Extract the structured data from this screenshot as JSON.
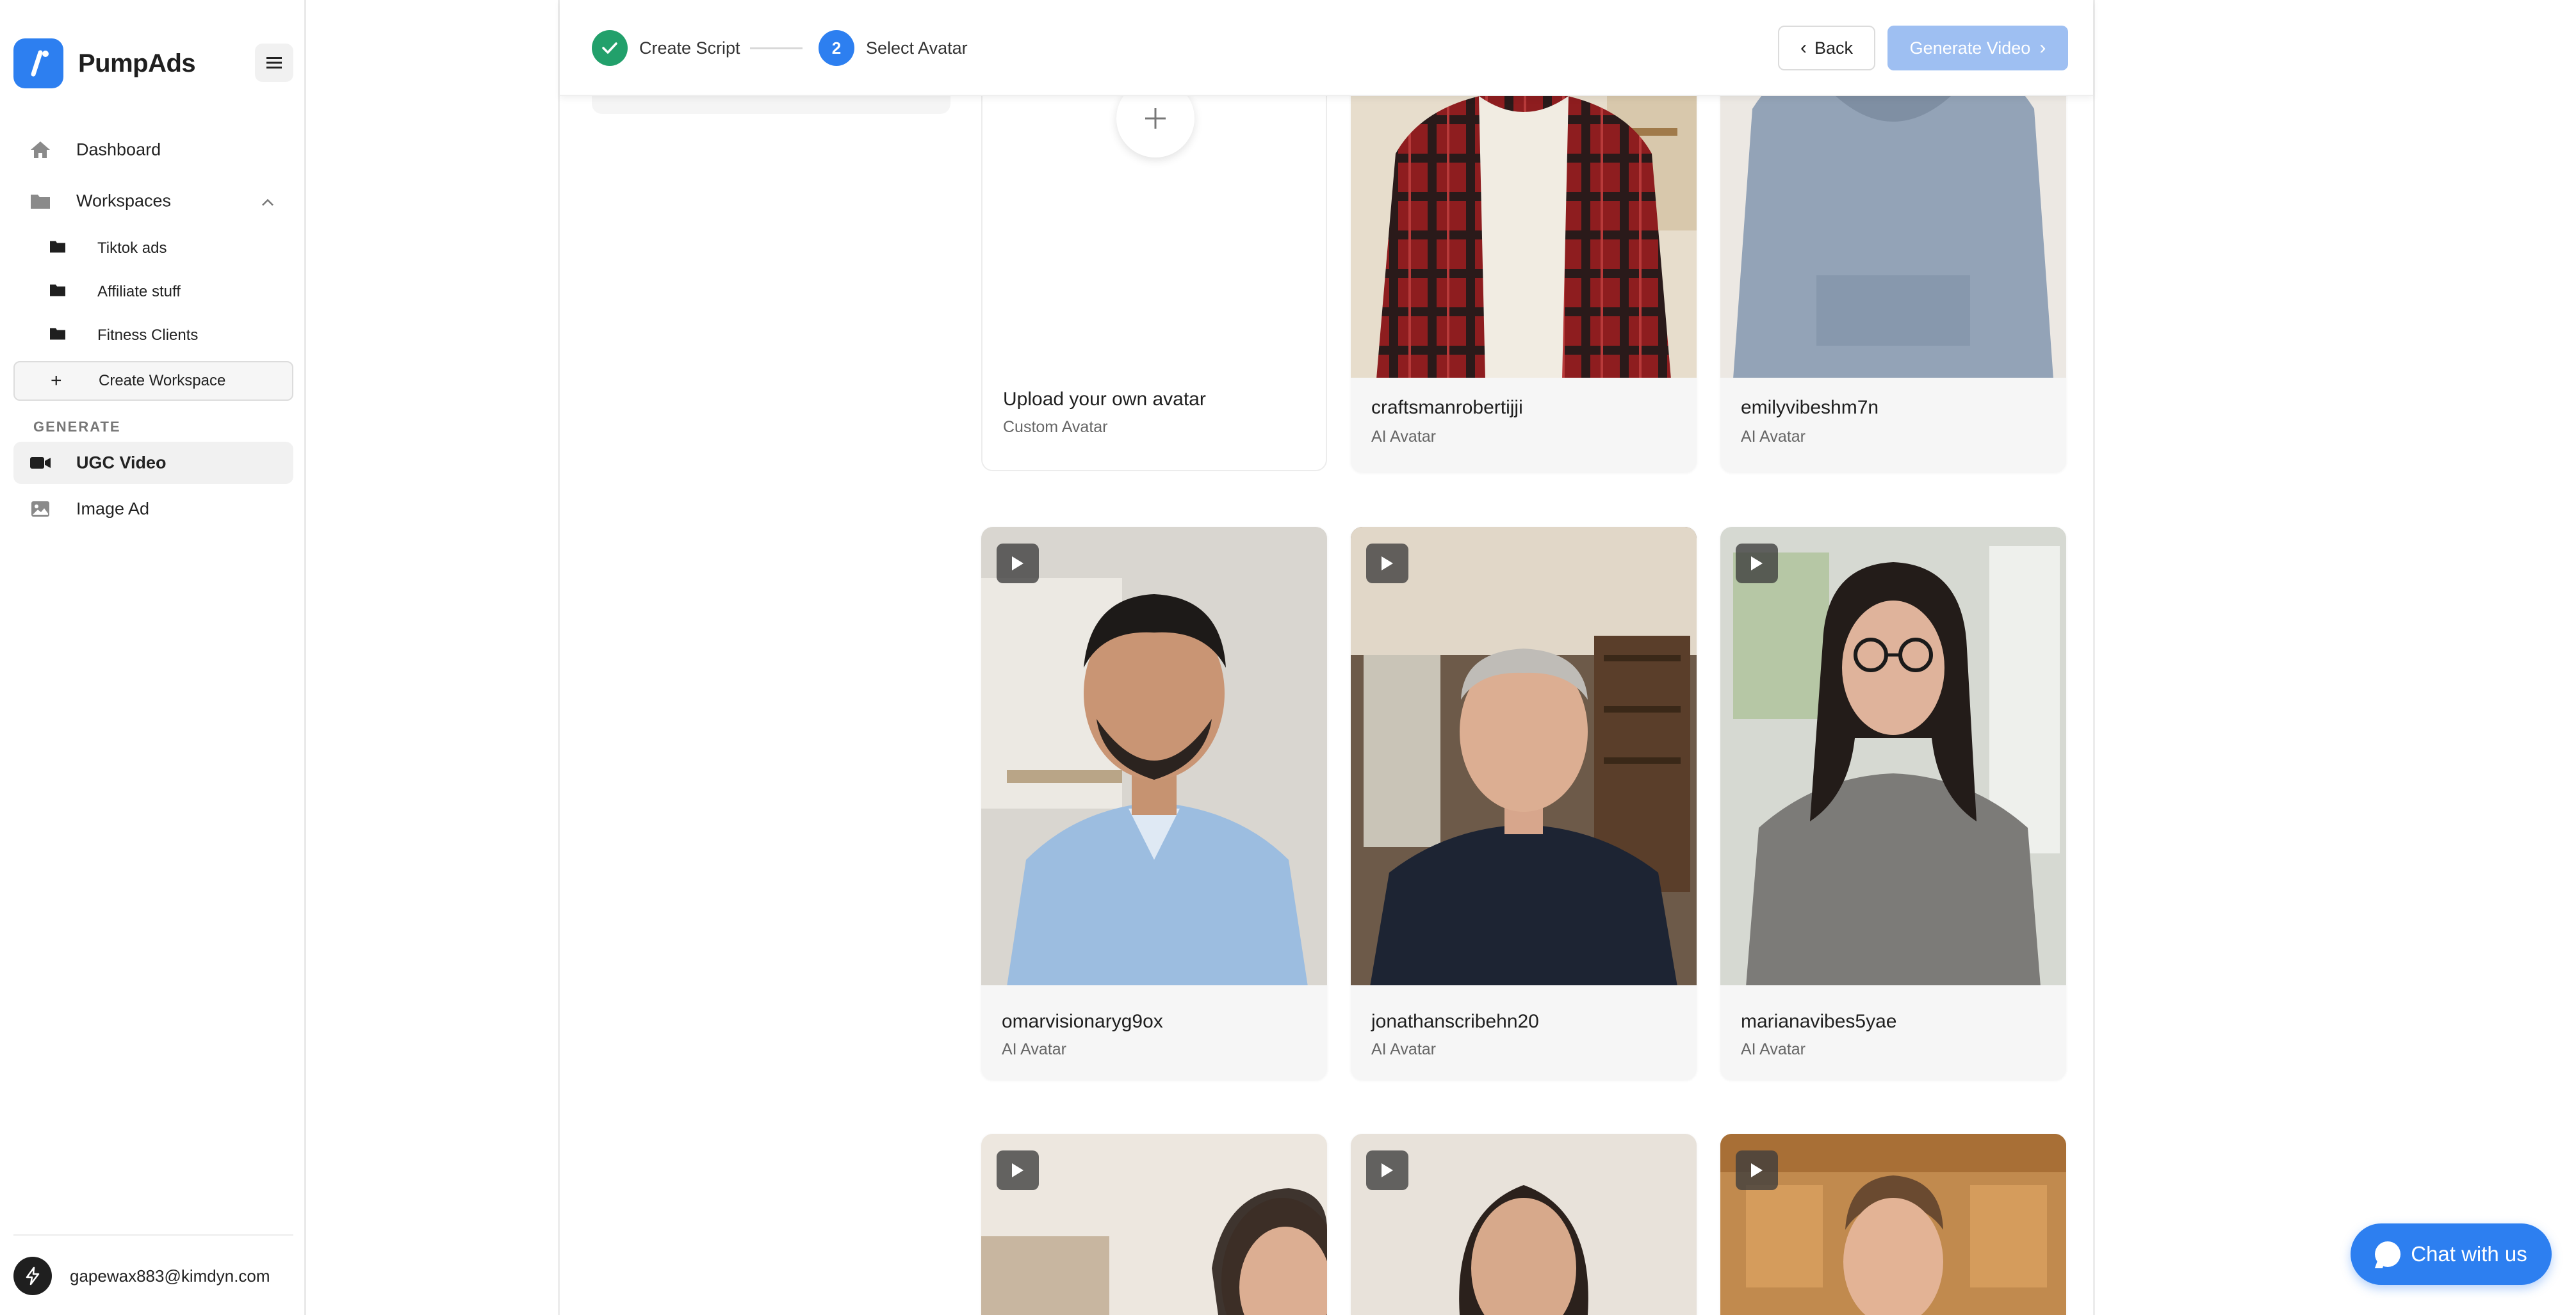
{
  "app": {
    "name": "PumpAds"
  },
  "sidebar": {
    "nav": [
      {
        "label": "Dashboard",
        "icon": "home-icon"
      },
      {
        "label": "Workspaces",
        "icon": "folder-icon"
      }
    ],
    "workspaces": [
      {
        "label": "Tiktok ads",
        "icon": "folder-icon"
      },
      {
        "label": "Affiliate stuff",
        "icon": "folder-icon"
      },
      {
        "label": "Fitness Clients",
        "icon": "folder-icon"
      }
    ],
    "create_workspace_label": "Create Workspace",
    "generate_section_label": "GENERATE",
    "generate": [
      {
        "label": "UGC Video",
        "icon": "video-icon",
        "active": true
      },
      {
        "label": "Image Ad",
        "icon": "image-icon",
        "active": false
      }
    ],
    "user_email": "gapewax883@kimdyn.com"
  },
  "stepper": {
    "steps": [
      {
        "number": "",
        "label": "Create Script",
        "status": "done"
      },
      {
        "number": "2",
        "label": "Select Avatar",
        "status": "current"
      }
    ]
  },
  "actions": {
    "back_label": "Back",
    "generate_label": "Generate Video"
  },
  "upload": {
    "title": "Upload your own avatar",
    "subtitle": "Custom Avatar"
  },
  "avatars": [
    {
      "name": "craftsmanrobertijji",
      "type": "AI Avatar"
    },
    {
      "name": "emilyvibeshm7n",
      "type": "AI Avatar"
    },
    {
      "name": "omarvisionaryg9ox",
      "type": "AI Avatar"
    },
    {
      "name": "jonathanscribehn20",
      "type": "AI Avatar"
    },
    {
      "name": "marianavibes5yae",
      "type": "AI Avatar"
    }
  ],
  "chat": {
    "label": "Chat with us"
  },
  "colors": {
    "accent": "#2d7ff0",
    "success": "#22a06b",
    "generate_disabled": "#9ebff2"
  }
}
